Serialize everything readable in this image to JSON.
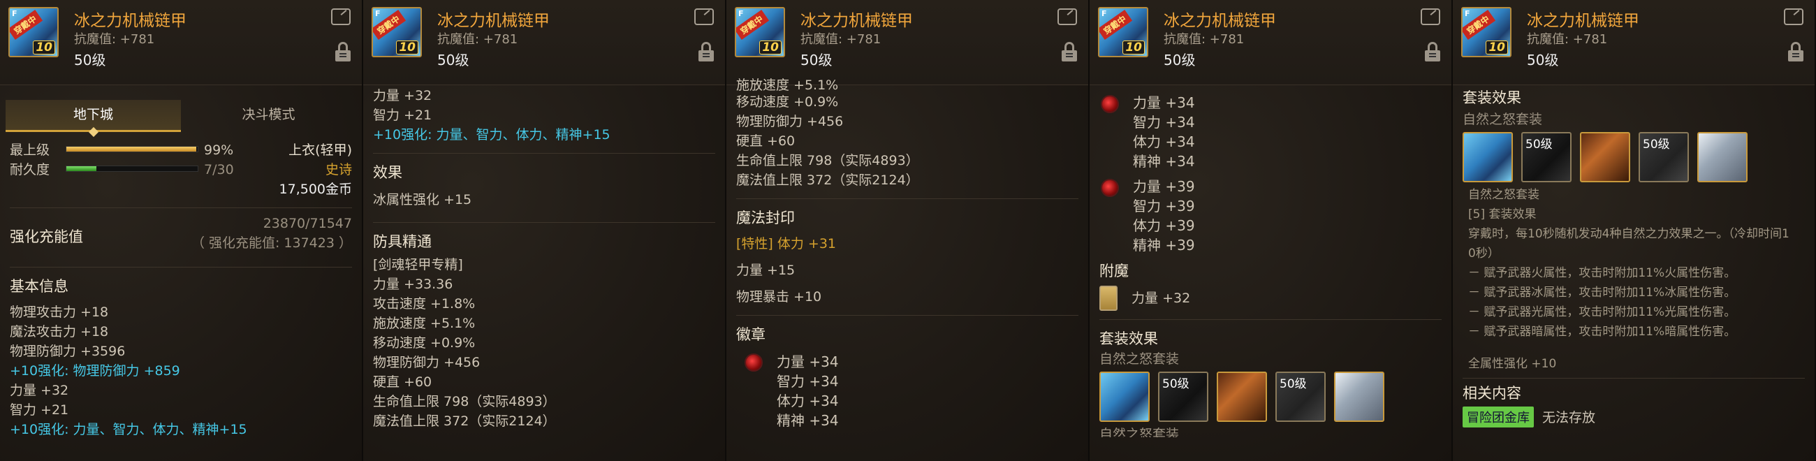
{
  "item": {
    "name": "冰之力机械链甲",
    "resist": "抗魔值: +781",
    "level": "50级",
    "badge": "穿戴中",
    "lv_num": "10",
    "f_mark": "F"
  },
  "colors": {
    "title": "#f1a63c",
    "enhance": "#46c8e6",
    "epic": "#d5a12e",
    "legend_green": "#67c945"
  },
  "p1": {
    "tabs": [
      "地下城",
      "决斗模式"
    ],
    "top_label": "最上级",
    "top_pct": "99%",
    "top_value": 0.99,
    "slot": "上衣(轻甲)",
    "rarity": "史诗",
    "dur_label": "耐久度",
    "dur_val": "7/30",
    "dur_value": 0.2333,
    "price": "17,500金币",
    "charge_label": "强化充能值",
    "charge_val": "23870/71547",
    "charge_sub": "（ 强化充能值: 137423 ）",
    "basic_title": "基本信息",
    "lines": [
      "物理攻击力 +18",
      "魔法攻击力 +18",
      "物理防御力 +3596"
    ],
    "enh1": "+10强化: 物理防御力 +859",
    "lines2": [
      "力量 +32",
      "智力 +21"
    ],
    "enh2": "+10强化: 力量、智力、体力、精神+15"
  },
  "p2": {
    "top": [
      "力量 +32",
      "智力 +21"
    ],
    "enh": "+10强化: 力量、智力、体力、精神+15",
    "effect_title": "效果",
    "effect": "冰属性强化 +15",
    "mastery_title": "防具精通",
    "mastery_sub": "[剑魂轻甲专精]",
    "mastery": [
      "力量 +33.36",
      "攻击速度 +1.8%",
      "施放速度 +5.1%",
      "移动速度 +0.9%",
      "物理防御力 +456",
      "硬直 +60",
      "生命值上限 798（实际4893）",
      "魔法值上限 372（实际2124）"
    ]
  },
  "p3": {
    "cut_top": "施放速度 +5.1%",
    "lines": [
      "移动速度 +0.9%",
      "物理防御力 +456",
      "硬直 +60",
      "生命值上限 798（实际4893）",
      "魔法值上限 372（实际2124）"
    ],
    "seal_title": "魔法封印",
    "seal_1": "[特性] 体力 +31",
    "seal_2": "力量 +15",
    "seal_3": "物理暴击 +10",
    "emblem_title": "徽章",
    "emblem": [
      "力量 +34",
      "智力 +34",
      "体力 +34",
      "精神 +34"
    ]
  },
  "p4": {
    "emblem1": [
      "力量 +34",
      "智力 +34",
      "体力 +34",
      "精神 +34"
    ],
    "emblem2": [
      "力量 +39",
      "智力 +39",
      "体力 +39",
      "精神 +39"
    ],
    "enchant_title": "附魔",
    "enchant": "力量 +32",
    "set_title": "套装效果",
    "set_name": "自然之怒套装",
    "set_level": "50级",
    "cut_bottom": "自然之怒套装"
  },
  "p5": {
    "set_title": "套装效果",
    "set_name": "自然之怒套装",
    "set_level": "50级",
    "set_name2": "自然之怒套装",
    "set_count": "[5] 套装效果",
    "desc1": "穿戴时，每10秒随机发动4种自然之力效果之一。（冷却时间1",
    "desc2": "0秒）",
    "effects": [
      "－ 赋予武器火属性，攻击时附加11%火属性伤害。",
      "－ 赋予武器冰属性，攻击时附加11%冰属性伤害。",
      "－ 赋予武器光属性，攻击时附加11%光属性伤害。",
      "－ 赋予武器暗属性，攻击时附加11%暗属性伤害。"
    ],
    "all_attr": "全属性强化 +10",
    "related_title": "相关内容",
    "related_btn": "冒险团金库",
    "related_text": "无法存放"
  }
}
